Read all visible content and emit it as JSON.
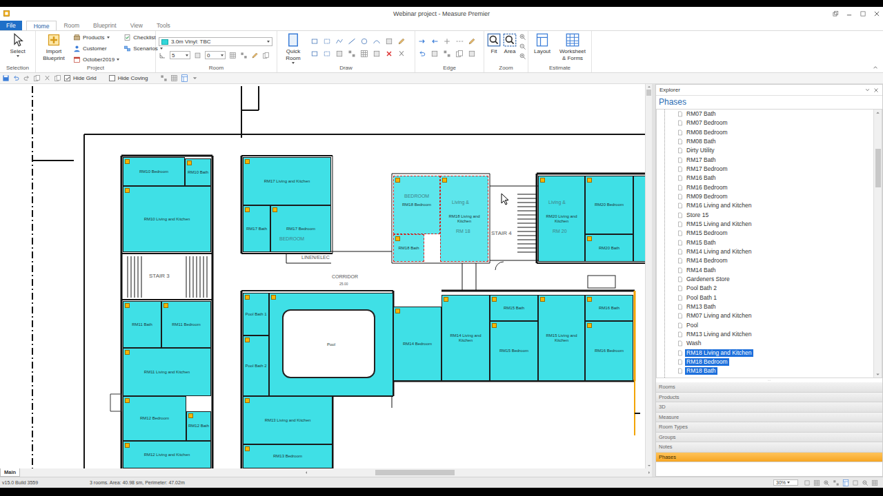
{
  "window": {
    "title": "Webinar project - Measure Premier"
  },
  "file_menu": "File",
  "ribbon_tabs": [
    {
      "label": "Home",
      "selected": true
    },
    {
      "label": "Room",
      "selected": false
    },
    {
      "label": "Blueprint",
      "selected": false
    },
    {
      "label": "View",
      "selected": false
    },
    {
      "label": "Tools",
      "selected": false
    }
  ],
  "ribbon": {
    "selection": {
      "label": "Selection",
      "select": "Select"
    },
    "project": {
      "label": "Project",
      "import": "Import Blueprint",
      "menu_a": [
        {
          "label": "Products",
          "dropdown": true
        },
        {
          "label": "Customer",
          "dropdown": false
        },
        {
          "label": "October2019",
          "dropdown": true
        }
      ],
      "menu_b": [
        {
          "label": "Checklist",
          "dropdown": false
        },
        {
          "label": "Scenarios",
          "dropdown": true
        }
      ]
    },
    "room": {
      "label": "Room",
      "product": "3.0m Vinyl: TBC",
      "value_a": "5",
      "value_b": "0"
    },
    "draw": {
      "label": "Draw",
      "quick_room": "Quick Room"
    },
    "edge": {
      "label": "Edge"
    },
    "zoom": {
      "label": "Zoom",
      "fit": "Fit",
      "area": "Area"
    },
    "estimate": {
      "label": "Estimate",
      "layout": "Layout",
      "worksheet": "Worksheet & Forms"
    }
  },
  "toolbar": {
    "hide_grid": {
      "label": "Hide Grid",
      "checked": true
    },
    "hide_coving": {
      "label": "Hide Coving",
      "checked": false
    }
  },
  "plan": {
    "rooms": [
      {
        "label": "RM10 Bedroom",
        "selected": false
      },
      {
        "label": "RM10 Bath",
        "selected": false
      },
      {
        "label": "RM10 Living and Kitchen",
        "selected": false
      },
      {
        "label": "RM11 Bath",
        "selected": false
      },
      {
        "label": "RM11 Bedroom",
        "selected": false
      },
      {
        "label": "RM11 Living and Kitchen",
        "selected": false
      },
      {
        "label": "RM12 Bedroom",
        "selected": false
      },
      {
        "label": "RM12 Bath",
        "selected": false
      },
      {
        "label": "RM12 Living and Kitchen",
        "selected": false
      },
      {
        "label": "RM17 Living and Kitchen",
        "selected": false
      },
      {
        "label": "RM17 Bedroom",
        "selected": false
      },
      {
        "label": "RM17 Bath",
        "selected": false
      },
      {
        "label": "Pool Bath 1",
        "selected": false
      },
      {
        "label": "Pool",
        "selected": false
      },
      {
        "label": "Pool Bath 2",
        "selected": false
      },
      {
        "label": "RM13 Living and Kitchen",
        "selected": false
      },
      {
        "label": "RM13 Bedroom",
        "selected": false
      },
      {
        "label": "RM18 Bedroom",
        "selected": true
      },
      {
        "label": "RM18 Bath",
        "selected": true
      },
      {
        "label": "RM18 Living and Kitchen",
        "selected": true
      },
      {
        "label": "RM20 Living and Kitchen",
        "selected": false
      },
      {
        "label": "RM20 Bedroom",
        "selected": false
      },
      {
        "label": "RM20 Bath",
        "selected": false
      },
      {
        "label": "RM14 Bedroom",
        "selected": false
      },
      {
        "label": "RM14 Living and Kitchen",
        "selected": false
      },
      {
        "label": "RM15 Bedroom",
        "selected": false
      },
      {
        "label": "RM15 Bath",
        "selected": false
      },
      {
        "label": "RM15 Living and Kitchen",
        "selected": false
      },
      {
        "label": "RM16 Bath",
        "selected": false
      },
      {
        "label": "RM16 Bedroom",
        "selected": false
      }
    ],
    "labels": [
      "STAIR 4",
      "CORRIDOR",
      "25.00",
      "LINEN/ELEC",
      "BEDROOM",
      "Living &",
      "RM 18",
      "Living &",
      "RM 20",
      "BEDROOM",
      "STAIR 3"
    ]
  },
  "canvas_tabs": [
    {
      "label": "Main",
      "selected": true
    }
  ],
  "explorer": {
    "title": "Explorer",
    "section": "Phases",
    "items": [
      {
        "label": "RM07 Bath",
        "selected": false
      },
      {
        "label": "RM07 Bedroom",
        "selected": false
      },
      {
        "label": "RM08 Bedroom",
        "selected": false
      },
      {
        "label": "RM08 Bath",
        "selected": false
      },
      {
        "label": "Dirty Utility",
        "selected": false
      },
      {
        "label": "RM17 Bath",
        "selected": false
      },
      {
        "label": "RM17 Bedroom",
        "selected": false
      },
      {
        "label": "RM16 Bath",
        "selected": false
      },
      {
        "label": "RM16 Bedroom",
        "selected": false
      },
      {
        "label": "RM09 Bedroom",
        "selected": false
      },
      {
        "label": "RM16 Living and Kitchen",
        "selected": false
      },
      {
        "label": "Store 15",
        "selected": false
      },
      {
        "label": "RM15 Living and Kitchen",
        "selected": false
      },
      {
        "label": "RM15 Bedroom",
        "selected": false
      },
      {
        "label": "RM15 Bath",
        "selected": false
      },
      {
        "label": "RM14 Living and Kitchen",
        "selected": false
      },
      {
        "label": "RM14 Bedroom",
        "selected": false
      },
      {
        "label": "RM14 Bath",
        "selected": false
      },
      {
        "label": "Gardeners Store",
        "selected": false
      },
      {
        "label": "Pool Bath 2",
        "selected": false
      },
      {
        "label": "Pool Bath 1",
        "selected": false
      },
      {
        "label": "RM13 Bath",
        "selected": false
      },
      {
        "label": "RM07 Living and Kitchen",
        "selected": false
      },
      {
        "label": "Pool",
        "selected": false
      },
      {
        "label": "RM13 Living and Kitchen",
        "selected": false
      },
      {
        "label": "Wash",
        "selected": false
      },
      {
        "label": "RM18 Living and Kitchen",
        "selected": true
      },
      {
        "label": "RM18 Bedroom",
        "selected": true
      },
      {
        "label": "RM18 Bath",
        "selected": true
      }
    ],
    "panels": [
      {
        "label": "Rooms",
        "active": false
      },
      {
        "label": "Products",
        "active": false
      },
      {
        "label": "3D",
        "active": false
      },
      {
        "label": "Measure",
        "active": false
      },
      {
        "label": "Room Types",
        "active": false
      },
      {
        "label": "Groups",
        "active": false
      },
      {
        "label": "Notes",
        "active": false
      },
      {
        "label": "Phases",
        "active": true
      }
    ]
  },
  "status_bar": {
    "build": "v15.0 Build 3559",
    "summary": "3 rooms. Area: 40.98 sm, Perimeter: 47.02m",
    "zoom": "30%"
  }
}
